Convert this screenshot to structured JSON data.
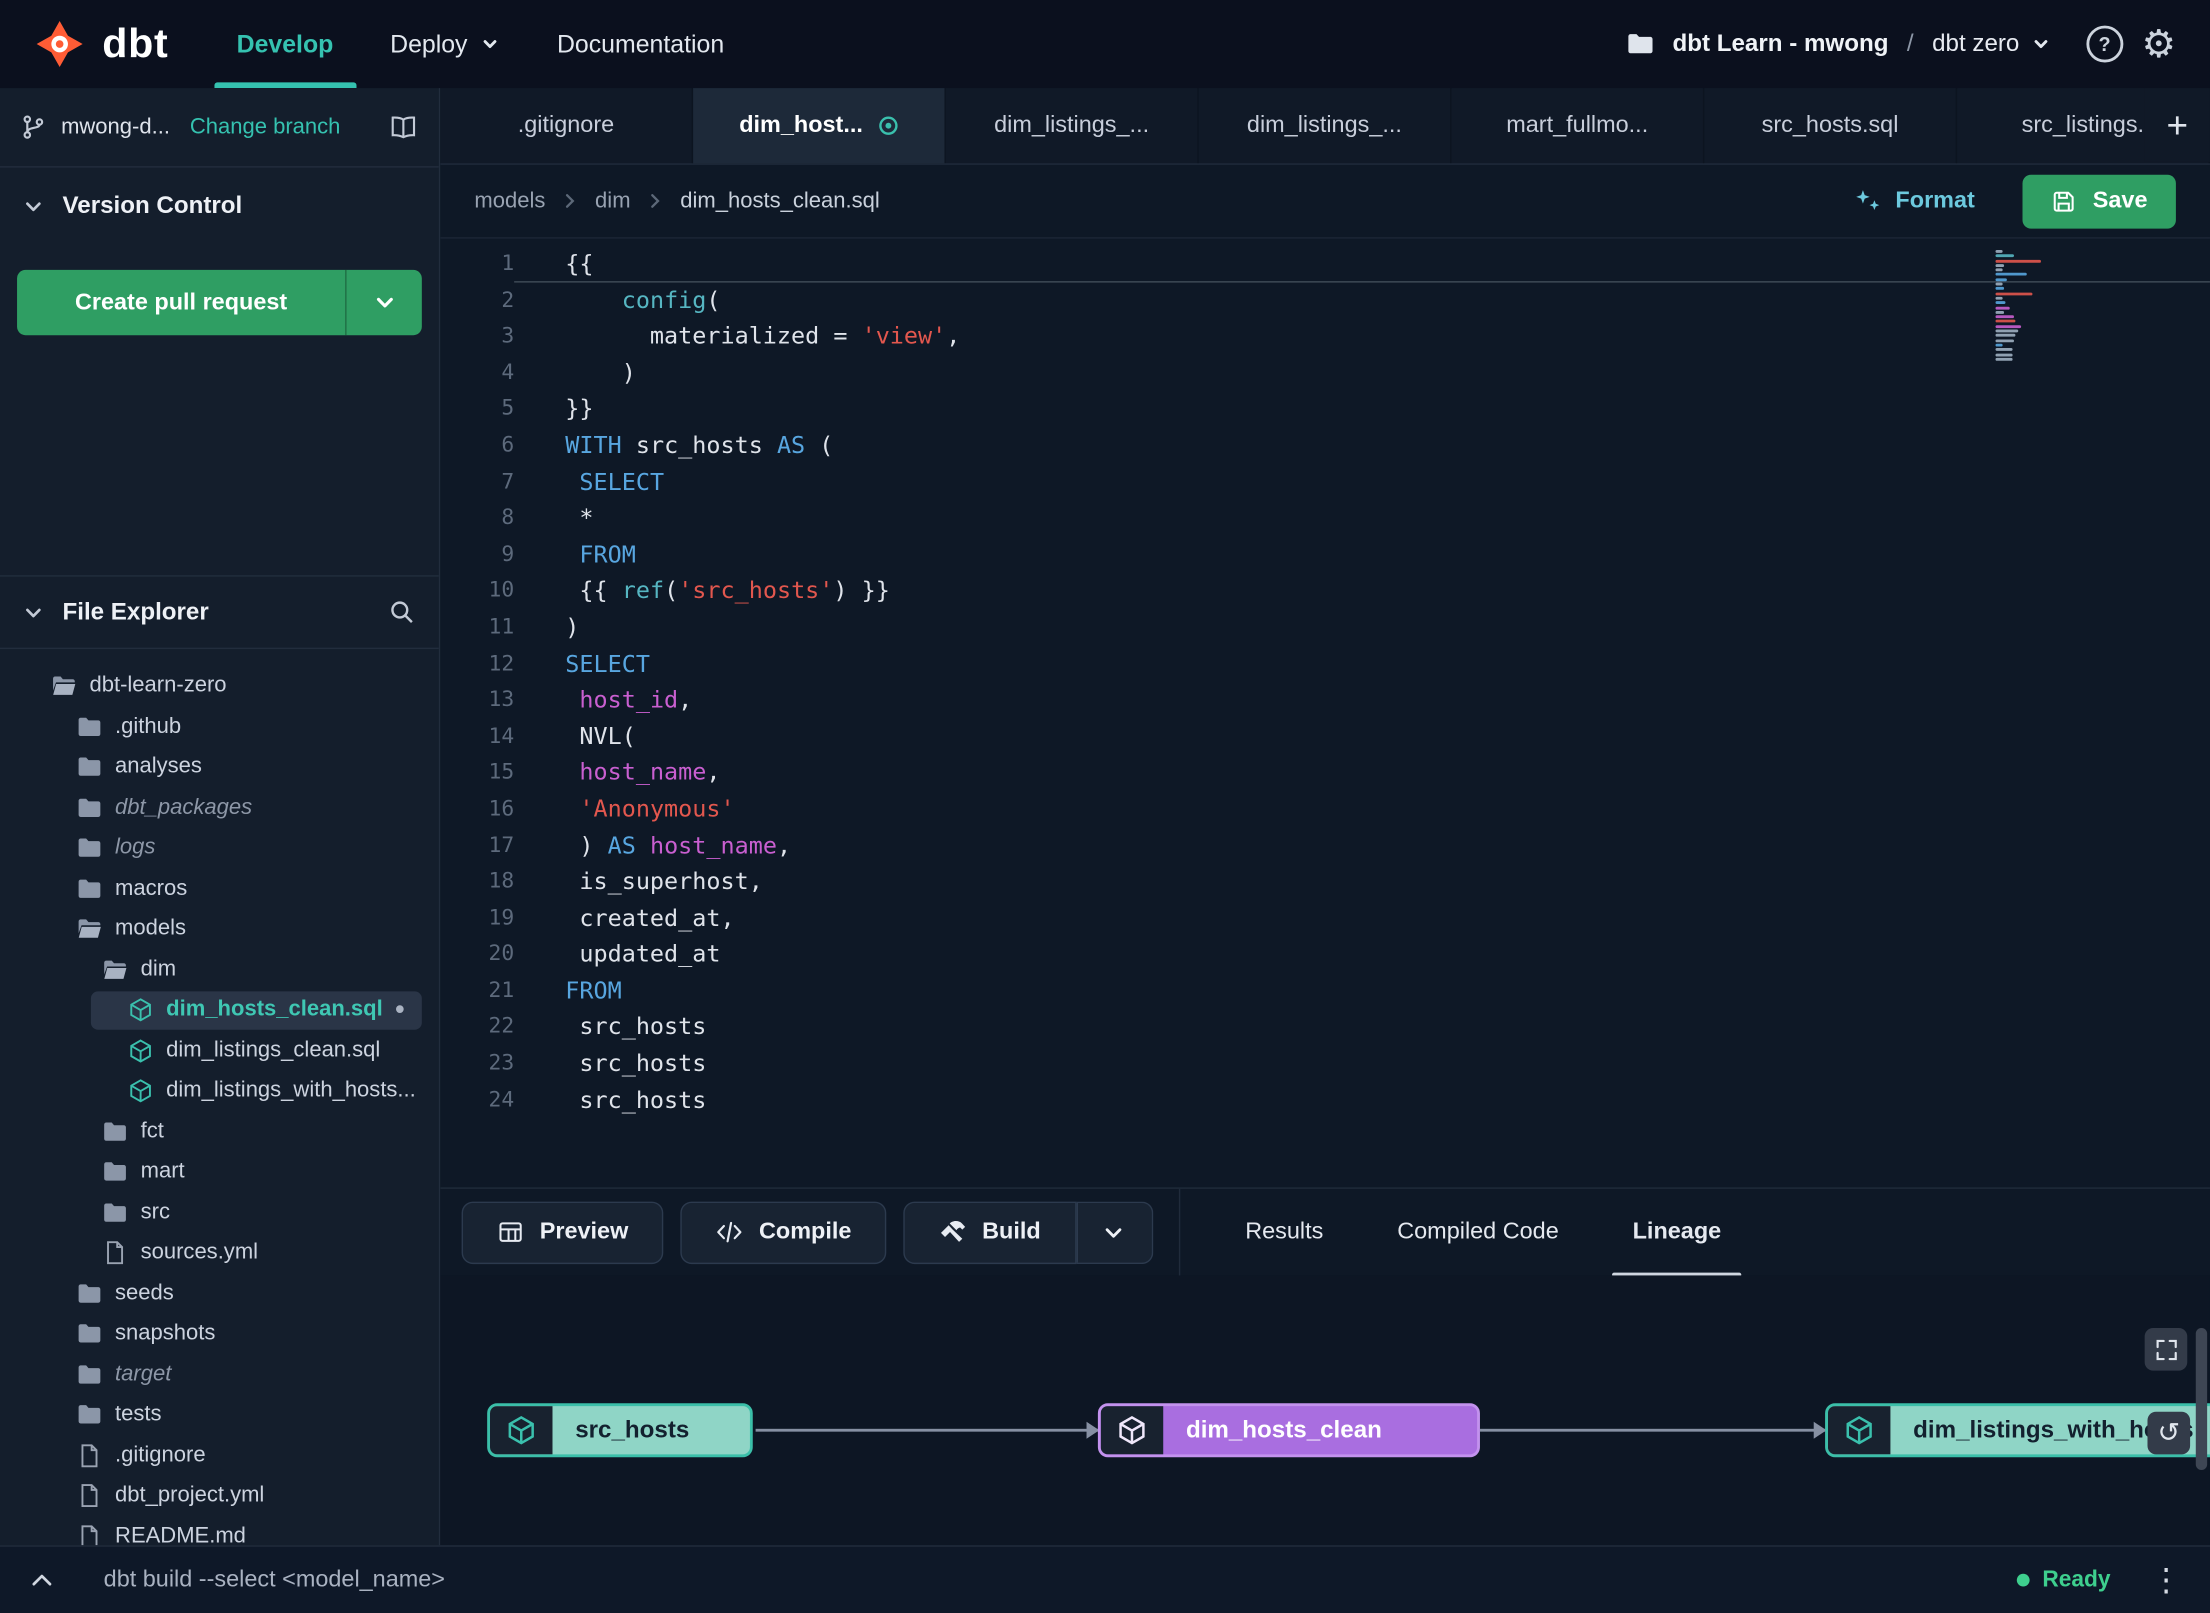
{
  "colors": {
    "accent": "#35c2b0",
    "green_button": "#2f9e63",
    "logo_orange": "#ff5c35",
    "code_keyword": "#58a6e0",
    "code_function": "#56b6c2",
    "code_string": "#e2574e",
    "code_variable": "#c95fd0",
    "code_plain": "#dfe3ea",
    "node_teal_bg": "#8fd5c6",
    "node_teal_border": "#3bbfa9",
    "node_teal_text": "#13212f",
    "node_purple_bg": "#a96ee0",
    "node_purple_border": "#c392ee",
    "node_purple_text": "#ffffff",
    "ready_green": "#3ecf8e"
  },
  "icons": {
    "plus": "+",
    "help": "?",
    "gear": "⚙",
    "kebab": "⋮",
    "undo": "↺",
    "dot": "•"
  },
  "navbar": {
    "brand": "dbt",
    "items": [
      {
        "label": "Develop",
        "active": true
      },
      {
        "label": "Deploy",
        "caret": true
      },
      {
        "label": "Documentation"
      }
    ],
    "project": "dbt Learn - mwong",
    "separator": "/",
    "env": "dbt zero"
  },
  "sidebar": {
    "branch": {
      "name": "mwong-d...",
      "change_label": "Change branch"
    },
    "version_control": {
      "title": "Version Control",
      "button_label": "Create pull request"
    },
    "file_explorer": {
      "title": "File Explorer"
    },
    "tree": [
      {
        "label": "dbt-learn-zero",
        "icon": "folder-open-icon",
        "level": 0
      },
      {
        "label": ".github",
        "icon": "folder-icon",
        "level": 1
      },
      {
        "label": "analyses",
        "icon": "folder-icon",
        "level": 1
      },
      {
        "label": "dbt_packages",
        "icon": "folder-icon",
        "level": 1,
        "italic": true
      },
      {
        "label": "logs",
        "icon": "folder-icon",
        "level": 1,
        "italic": true
      },
      {
        "label": "macros",
        "icon": "folder-icon",
        "level": 1
      },
      {
        "label": "models",
        "icon": "folder-open-icon",
        "level": 1
      },
      {
        "label": "dim",
        "icon": "folder-open-icon",
        "level": 2
      },
      {
        "label": "dim_hosts_clean.sql",
        "icon": "model-icon",
        "level": 3,
        "selected": true,
        "dirty": true
      },
      {
        "label": "dim_listings_clean.sql",
        "icon": "model-icon",
        "level": 3
      },
      {
        "label": "dim_listings_with_hosts...",
        "icon": "model-icon",
        "level": 3
      },
      {
        "label": "fct",
        "icon": "folder-icon",
        "level": 2
      },
      {
        "label": "mart",
        "icon": "folder-icon",
        "level": 2
      },
      {
        "label": "src",
        "icon": "folder-icon",
        "level": 2
      },
      {
        "label": "sources.yml",
        "icon": "file-icon",
        "level": 2
      },
      {
        "label": "seeds",
        "icon": "folder-icon",
        "level": 1
      },
      {
        "label": "snapshots",
        "icon": "folder-icon",
        "level": 1
      },
      {
        "label": "target",
        "icon": "folder-icon",
        "level": 1,
        "italic": true
      },
      {
        "label": "tests",
        "icon": "folder-icon",
        "level": 1
      },
      {
        "label": ".gitignore",
        "icon": "file-icon",
        "level": 1
      },
      {
        "label": "dbt_project.yml",
        "icon": "file-icon",
        "level": 1
      },
      {
        "label": "README.md",
        "icon": "file-icon",
        "level": 1
      }
    ]
  },
  "editor": {
    "tabs": [
      {
        "label": ".gitignore"
      },
      {
        "label": "dim_host...",
        "active": true,
        "dirty": true
      },
      {
        "label": "dim_listings_..."
      },
      {
        "label": "dim_listings_..."
      },
      {
        "label": "mart_fullmo..."
      },
      {
        "label": "src_hosts.sql"
      },
      {
        "label": "src_listings."
      }
    ],
    "breadcrumb": [
      "models",
      "dim",
      "dim_hosts_clean.sql"
    ],
    "format_label": "Format",
    "save_label": "Save",
    "code": {
      "lines": [
        {
          "n": 1,
          "active": true,
          "t": [
            [
              "{{",
              "p"
            ]
          ]
        },
        {
          "n": 2,
          "t": [
            [
              "    ",
              "p"
            ],
            [
              "config",
              "f"
            ],
            [
              "(",
              "p"
            ]
          ]
        },
        {
          "n": 3,
          "t": [
            [
              "      materialized = ",
              "p"
            ],
            [
              "'view'",
              "s"
            ],
            [
              ",",
              "p"
            ]
          ]
        },
        {
          "n": 4,
          "t": [
            [
              "    )",
              "p"
            ]
          ]
        },
        {
          "n": 5,
          "t": [
            [
              "}}",
              "p"
            ]
          ]
        },
        {
          "n": 6,
          "t": [
            [
              "WITH",
              "k"
            ],
            [
              " src_hosts ",
              "p"
            ],
            [
              "AS",
              "k"
            ],
            [
              " (",
              "p"
            ]
          ]
        },
        {
          "n": 7,
          "t": [
            [
              " ",
              "p"
            ],
            [
              "SELECT",
              "k"
            ]
          ]
        },
        {
          "n": 8,
          "t": [
            [
              " *",
              "p"
            ]
          ]
        },
        {
          "n": 9,
          "t": [
            [
              " ",
              "p"
            ],
            [
              "FROM",
              "k"
            ]
          ]
        },
        {
          "n": 10,
          "t": [
            [
              " {{ ",
              "p"
            ],
            [
              "ref",
              "f"
            ],
            [
              "(",
              "p"
            ],
            [
              "'src_hosts'",
              "s"
            ],
            [
              ") }}",
              "p"
            ]
          ]
        },
        {
          "n": 11,
          "t": [
            [
              ")",
              "p"
            ]
          ]
        },
        {
          "n": 12,
          "t": [
            [
              "SELECT",
              "k"
            ]
          ]
        },
        {
          "n": 13,
          "t": [
            [
              " ",
              "p"
            ],
            [
              "host_id",
              "v"
            ],
            [
              ",",
              "p"
            ]
          ]
        },
        {
          "n": 14,
          "t": [
            [
              " NVL(",
              "p"
            ]
          ]
        },
        {
          "n": 15,
          "t": [
            [
              " ",
              "p"
            ],
            [
              "host_name",
              "v"
            ],
            [
              ",",
              "p"
            ]
          ]
        },
        {
          "n": 16,
          "t": [
            [
              " ",
              "p"
            ],
            [
              "'Anonymous'",
              "s"
            ]
          ]
        },
        {
          "n": 17,
          "t": [
            [
              " ) ",
              "p"
            ],
            [
              "AS",
              "k"
            ],
            [
              " ",
              "p"
            ],
            [
              "host_name",
              "v"
            ],
            [
              ",",
              "p"
            ]
          ]
        },
        {
          "n": 18,
          "t": [
            [
              " is_superhost,",
              "p"
            ]
          ]
        },
        {
          "n": 19,
          "t": [
            [
              " created_at,",
              "p"
            ]
          ]
        },
        {
          "n": 20,
          "t": [
            [
              " updated_at",
              "p"
            ]
          ]
        },
        {
          "n": 21,
          "t": [
            [
              "FROM",
              "k"
            ]
          ]
        },
        {
          "n": 22,
          "t": [
            [
              " src_hosts",
              "p"
            ]
          ]
        },
        {
          "n": 23,
          "t": [
            [
              " src_hosts",
              "p"
            ]
          ]
        },
        {
          "n": 24,
          "t": [
            [
              " src_hosts",
              "p"
            ]
          ]
        }
      ]
    }
  },
  "panel": {
    "actions": [
      {
        "label": "Preview",
        "icon": "table-icon"
      },
      {
        "label": "Compile",
        "icon": "code-icon"
      },
      {
        "label": "Build",
        "icon": "hammer-icon",
        "split": true
      }
    ],
    "tabs": [
      {
        "label": "Results"
      },
      {
        "label": "Compiled Code"
      },
      {
        "label": "Lineage",
        "active": true
      }
    ],
    "lineage": {
      "nodes": [
        {
          "label": "src_hosts",
          "color": "teal"
        },
        {
          "label": "dim_hosts_clean",
          "color": "purple"
        },
        {
          "label": "dim_listings_with_hosts",
          "color": "teal"
        }
      ]
    }
  },
  "statusbar": {
    "command": "dbt build --select <model_name>",
    "ready_label": "Ready"
  }
}
